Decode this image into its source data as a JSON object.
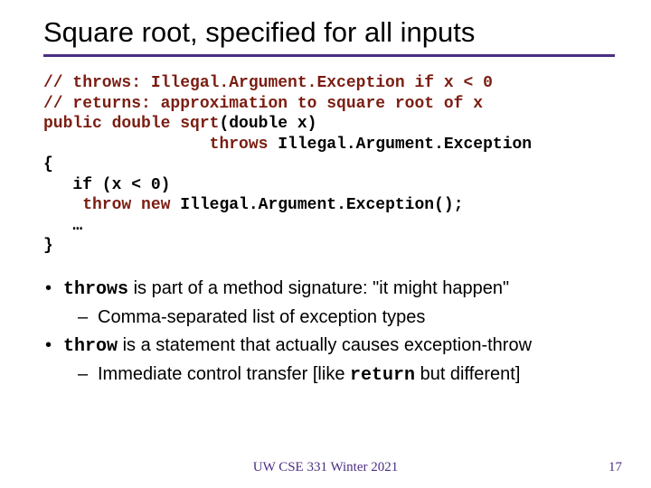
{
  "title": "Square root, specified for all inputs",
  "code": {
    "l1_a": "// throws: Illegal.Argument.Exception if x < 0",
    "l2_a": "// returns: approximation to square root of x",
    "l3_a": "public double sqrt",
    "l3_b": "(double x)",
    "l4_pad": "                 ",
    "l4_a": "throws",
    "l4_b": " Illegal.Argument.Exception",
    "l5_a": "{",
    "l6_a": "   if (x < 0)",
    "l7_a": "    throw new",
    "l7_b": " Illegal.Argument.Exception();",
    "l8_a": "   …",
    "l9_a": "}"
  },
  "bullets": {
    "b1a_code": "throws",
    "b1a_rest": " is part of a method signature: \"it might happen\"",
    "b1a_sub": "Comma-separated list of exception types",
    "b1b_code": "throw",
    "b1b_rest": " is a statement that actually causes exception-throw",
    "b1b_sub_a": "Immediate control transfer [like ",
    "b1b_sub_code": "return",
    "b1b_sub_b": " but different]"
  },
  "footer": {
    "center": "UW CSE 331 Winter 2021",
    "page": "17"
  }
}
